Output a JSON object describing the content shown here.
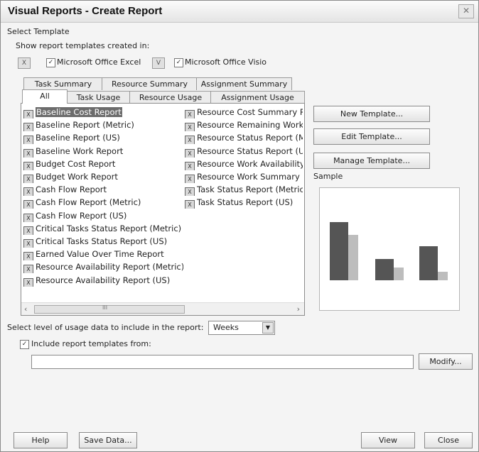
{
  "dialog": {
    "title": "Visual Reports - Create Report",
    "close_label": "✕"
  },
  "select_template_label": "Select Template",
  "show_templates_label": "Show report templates created in:",
  "apps": {
    "excel_label": "Microsoft Office Excel",
    "visio_label": "Microsoft Office Visio"
  },
  "tabs": {
    "row1": [
      "Task Summary",
      "Resource Summary",
      "Assignment Summary"
    ],
    "row2": [
      "All",
      "Task Usage",
      "Resource Usage",
      "Assignment Usage"
    ]
  },
  "templates": {
    "col1": [
      "Baseline Cost Report",
      "Baseline Report (Metric)",
      "Baseline Report (US)",
      "Baseline Work Report",
      "Budget Cost Report",
      "Budget Work Report",
      "Cash Flow Report",
      "Cash Flow Report (Metric)",
      "Cash Flow Report (US)",
      "Critical Tasks Status Report (Metric)",
      "Critical Tasks Status Report (US)",
      "Earned Value Over Time Report",
      "Resource Availability Report (Metric)",
      "Resource Availability Report (US)"
    ],
    "col2": [
      "Resource Cost Summary Re",
      "Resource Remaining Work",
      "Resource Status Report (M",
      "Resource Status Report (U:",
      "Resource Work Availability",
      "Resource Work Summary R",
      "Task Status Report (Metric)",
      "Task Status Report (US)"
    ],
    "selected": "Baseline Cost Report"
  },
  "buttons": {
    "new_template": "New Template...",
    "edit_template": "Edit Template...",
    "manage_template": "Manage Template...",
    "modify": "Modify...",
    "help": "Help",
    "save_data": "Save Data...",
    "view": "View",
    "close": "Close"
  },
  "sample_label": "Sample",
  "usage": {
    "label": "Select level of usage data to include in the report:",
    "value": "Weeks"
  },
  "include_label": "Include report templates from:",
  "include_path": "",
  "scroll_glyph": "III",
  "colors": {
    "bar_dark": "#555555",
    "bar_light": "#bdbdbd",
    "selected_bg": "#6c6c6c"
  }
}
